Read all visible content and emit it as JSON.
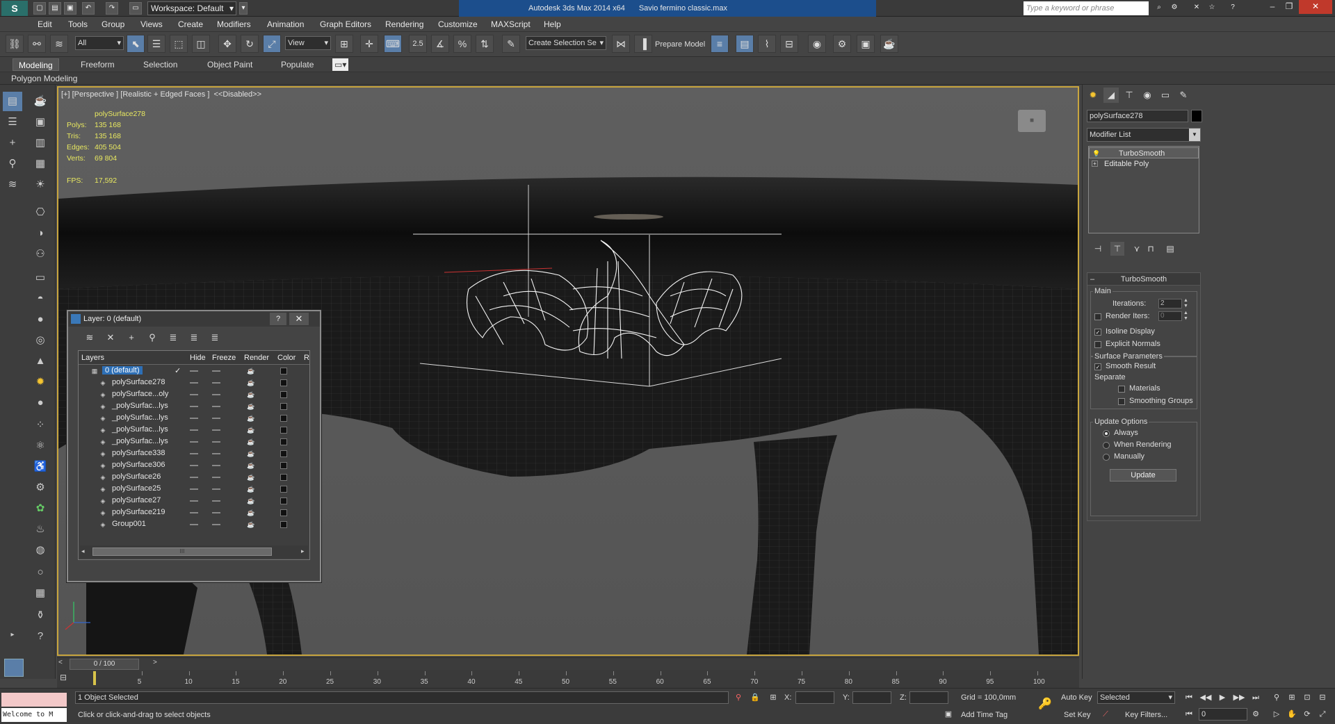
{
  "title_bar": {
    "workspace": "Workspace: Default",
    "app_title": "Autodesk 3ds Max  2014 x64",
    "file_name": "Savio fermino classic.max",
    "search_placeholder": "Type a keyword or phrase"
  },
  "menu": [
    "Edit",
    "Tools",
    "Group",
    "Views",
    "Create",
    "Modifiers",
    "Animation",
    "Graph Editors",
    "Rendering",
    "Customize",
    "MAXScript",
    "Help"
  ],
  "toolbar": {
    "selection_filter": "All",
    "ref_coord": "View",
    "snap_label": "2.5",
    "named_selection": "Create Selection Se",
    "prepare_model": "Prepare Model"
  },
  "ribbon": {
    "tabs": [
      "Modeling",
      "Freeform",
      "Selection",
      "Object Paint",
      "Populate"
    ],
    "panel_label": "Polygon Modeling"
  },
  "viewport": {
    "label": "[+] [Perspective ] [Realistic + Edged Faces ]  <<Disabled>>",
    "object_name": "polySurface278",
    "stats": [
      {
        "label": "Polys:",
        "value": "135 168"
      },
      {
        "label": "Tris:",
        "value": "135 168"
      },
      {
        "label": "Edges:",
        "value": "405 504"
      },
      {
        "label": "Verts:",
        "value": "69 804"
      }
    ],
    "fps_label": "FPS:",
    "fps_value": "17,592"
  },
  "layer_dialog": {
    "title": "Layer: 0 (default)",
    "help": "?",
    "columns": [
      "Layers",
      "Hide",
      "Freeze",
      "Render",
      "Color",
      "R"
    ],
    "rows": [
      {
        "name": "0 (default)",
        "root": true
      },
      {
        "name": "polySurface278"
      },
      {
        "name": "polySurface...oly"
      },
      {
        "name": "_polySurfac...lys"
      },
      {
        "name": "_polySurfac...lys"
      },
      {
        "name": "_polySurfac...lys"
      },
      {
        "name": "_polySurfac...lys"
      },
      {
        "name": "polySurface338"
      },
      {
        "name": "polySurface306"
      },
      {
        "name": "polySurface26"
      },
      {
        "name": "polySurface25"
      },
      {
        "name": "polySurface27"
      },
      {
        "name": "polySurface219"
      },
      {
        "name": "Group001"
      }
    ],
    "scroll_thumb": "III"
  },
  "command_panel": {
    "object_name": "polySurface278",
    "modifier_list": "Modifier List",
    "stack": [
      "TurboSmooth",
      "Editable Poly"
    ],
    "rollout_title": "TurboSmooth",
    "main_group": "Main",
    "iterations_label": "Iterations:",
    "iterations_value": "2",
    "render_iters_label": "Render Iters:",
    "render_iters_value": "0",
    "isoline_display": "Isoline Display",
    "explicit_normals": "Explicit Normals",
    "surface_params": "Surface Parameters",
    "smooth_result": "Smooth Result",
    "separate": "Separate",
    "materials": "Materials",
    "smoothing_groups": "Smoothing Groups",
    "update_options": "Update Options",
    "always": "Always",
    "when_rendering": "When Rendering",
    "manually": "Manually",
    "update_button": "Update"
  },
  "timeline": {
    "frame": "0 / 100",
    "ticks": [
      "5",
      "10",
      "15",
      "20",
      "25",
      "30",
      "35",
      "40",
      "45",
      "50",
      "55",
      "60",
      "65",
      "70",
      "75",
      "80",
      "85",
      "90",
      "95",
      "100"
    ]
  },
  "status": {
    "welcome": "Welcome to M",
    "selection": "1 Object Selected",
    "prompt": "Click or click-and-drag to select objects",
    "x_label": "X:",
    "y_label": "Y:",
    "z_label": "Z:",
    "grid": "Grid = 100,0mm",
    "add_time_tag": "Add Time Tag",
    "auto_key": "Auto Key",
    "set_key": "Set Key",
    "selected": "Selected",
    "key_filters": "Key Filters...",
    "frame_value": "0"
  }
}
